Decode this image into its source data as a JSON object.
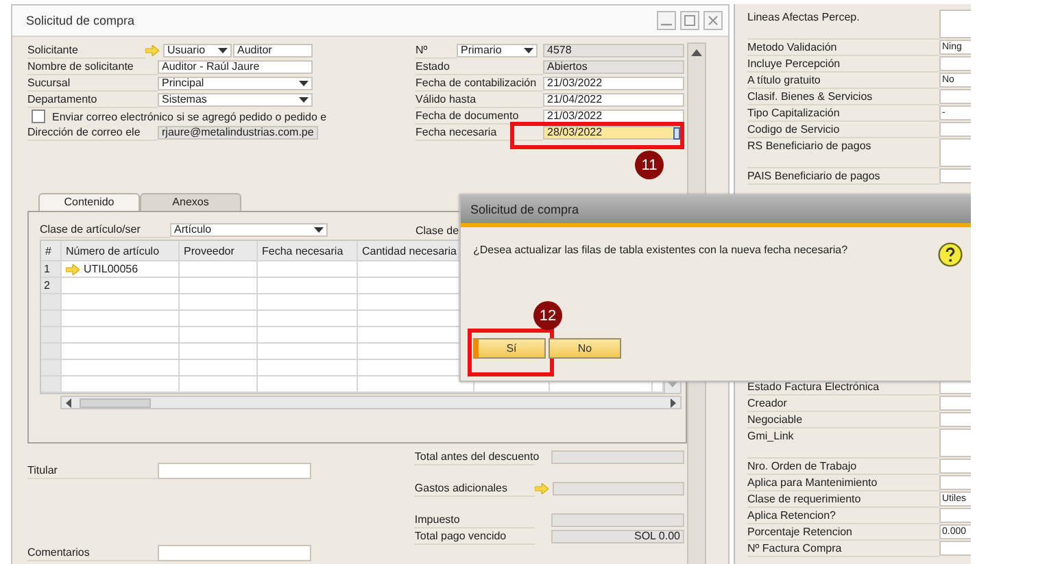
{
  "window": {
    "title": "Solicitud de compra"
  },
  "header_left": [
    {
      "kind": "user",
      "label": "Solicitante",
      "select": "Usuario",
      "value": "Auditor"
    },
    {
      "kind": "text",
      "label": "Nombre de solicitante",
      "value": "Auditor - Raúl Jaure"
    },
    {
      "kind": "select",
      "label": "Sucursal",
      "value": "Principal"
    },
    {
      "kind": "select",
      "label": "Departamento",
      "value": "Sistemas"
    },
    {
      "kind": "checkbox",
      "label": "Enviar correo electrónico si se agregó pedido o pedido e",
      "checked": false
    },
    {
      "kind": "readonly",
      "label": "Dirección de correo ele",
      "value": "rjaure@metalindustrias.com.pe"
    }
  ],
  "header_right": [
    {
      "kind": "number",
      "label": "Nº",
      "select": "Primario",
      "value": "4578"
    },
    {
      "kind": "readonly",
      "label": "Estado",
      "value": "Abiertos"
    },
    {
      "kind": "text",
      "label": "Fecha de contabilización",
      "value": "21/03/2022"
    },
    {
      "kind": "text",
      "label": "Válido hasta",
      "value": "21/04/2022"
    },
    {
      "kind": "text",
      "label": "Fecha de documento",
      "value": "21/03/2022"
    },
    {
      "kind": "focused",
      "label": "Fecha necesaria",
      "value": "28/03/2022",
      "callout": "11"
    }
  ],
  "tabs": [
    {
      "label": "Contenido",
      "selected": true
    },
    {
      "label": "Anexos",
      "selected": false
    }
  ],
  "item_class": {
    "label": "Clase de artículo/ser",
    "value": "Artículo",
    "second_label": "Clase de"
  },
  "table": {
    "columns": [
      "#",
      "Número de artículo",
      "Proveedor",
      "Fecha necesaria",
      "Cantidad necesaria"
    ],
    "rows": [
      {
        "number": "1",
        "item": "UTIL00056"
      },
      {
        "number": "2"
      }
    ]
  },
  "footer_left": [
    {
      "label": "Titular"
    },
    {
      "label": "Comentarios"
    }
  ],
  "totals": [
    {
      "label": "Total antes del descuento"
    },
    {
      "label": "Gastos adicionales",
      "link": true
    },
    {
      "label": "Impuesto"
    },
    {
      "label": "Total pago vencido",
      "value": "SOL 0.00"
    }
  ],
  "side_top": [
    {
      "label": "Lineas Afectas Percep.",
      "multiline": true
    },
    {
      "label": "Metodo Validación",
      "value": "Ning"
    },
    {
      "label": "Incluye Percepción"
    },
    {
      "label": "A título gratuito",
      "value": "No"
    },
    {
      "label": "Clasif. Bienes & Servicios"
    },
    {
      "label": "Tipo Capitalización",
      "value": "-"
    },
    {
      "label": "Codigo de Servicio"
    },
    {
      "label": "RS Beneficiario de pagos",
      "multiline": true
    },
    {
      "label": "PAIS Beneficiario de pagos"
    }
  ],
  "side_bottom": [
    {
      "label": "Estado Factura Electrónica"
    },
    {
      "label": "Creador"
    },
    {
      "label": "Negociable"
    },
    {
      "label": "Gmi_Link",
      "multiline": true
    },
    {
      "label": "Nro. Orden de Trabajo"
    },
    {
      "label": "Aplica para Mantenimiento"
    },
    {
      "label": "Clase de requerimiento",
      "value": "Utiles"
    },
    {
      "label": "Aplica Retencion?"
    },
    {
      "label": "Porcentaje Retencion",
      "value": "0.000"
    },
    {
      "label": "Nº Factura Compra"
    }
  ],
  "dialog": {
    "title": "Solicitud de compra",
    "message": "¿Desea actualizar las filas de tabla existentes con la nueva fecha necesaria?",
    "buttons": [
      {
        "label": "Sí",
        "focused": true,
        "callout": "12"
      },
      {
        "label": "No",
        "focused": false
      }
    ]
  }
}
